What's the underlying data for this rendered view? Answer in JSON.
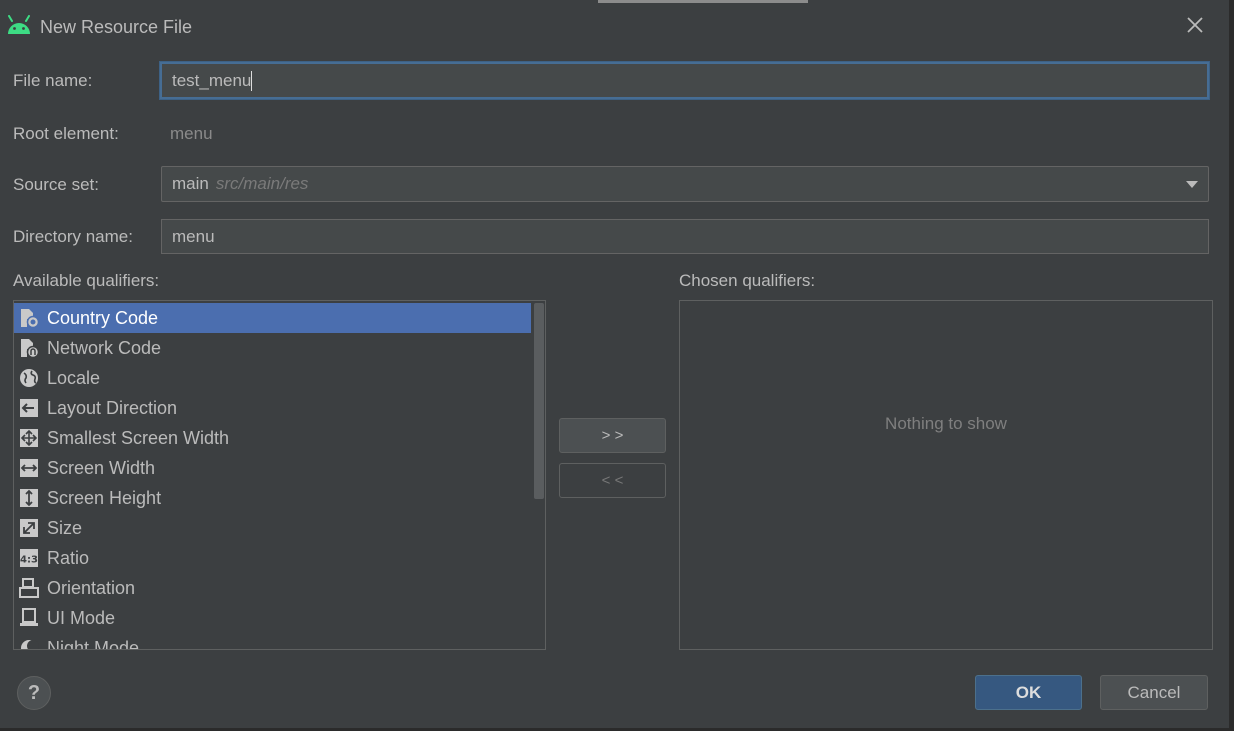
{
  "dialog": {
    "title": "New Resource File"
  },
  "form": {
    "file_name_label": "File name:",
    "file_name_value": "test_menu",
    "root_element_label": "Root element:",
    "root_element_value": "menu",
    "source_set_label": "Source set:",
    "source_set_value": "main",
    "source_set_hint": "src/main/res",
    "directory_name_label": "Directory name:",
    "directory_name_value": "menu"
  },
  "qualifiers": {
    "available_label": "Available qualifiers:",
    "chosen_label": "Chosen qualifiers:",
    "available": [
      {
        "label": "Country Code",
        "icon": "country-code-icon",
        "selected": true
      },
      {
        "label": "Network Code",
        "icon": "network-code-icon"
      },
      {
        "label": "Locale",
        "icon": "globe-icon"
      },
      {
        "label": "Layout Direction",
        "icon": "layout-direction-icon"
      },
      {
        "label": "Smallest Screen Width",
        "icon": "smallest-width-icon"
      },
      {
        "label": "Screen Width",
        "icon": "screen-width-icon"
      },
      {
        "label": "Screen Height",
        "icon": "screen-height-icon"
      },
      {
        "label": "Size",
        "icon": "size-icon"
      },
      {
        "label": "Ratio",
        "icon": "ratio-icon"
      },
      {
        "label": "Orientation",
        "icon": "orientation-icon"
      },
      {
        "label": "UI Mode",
        "icon": "ui-mode-icon"
      },
      {
        "label": "Night Mode",
        "icon": "night-mode-icon"
      }
    ],
    "add_button": "> >",
    "remove_button": "< <",
    "chosen_empty": "Nothing to show"
  },
  "footer": {
    "help": "?",
    "ok": "OK",
    "cancel": "Cancel"
  },
  "colors": {
    "background": "#3c3f41",
    "selection": "#4b6eaf",
    "primary_button": "#365880",
    "android_green": "#3ddc84"
  }
}
